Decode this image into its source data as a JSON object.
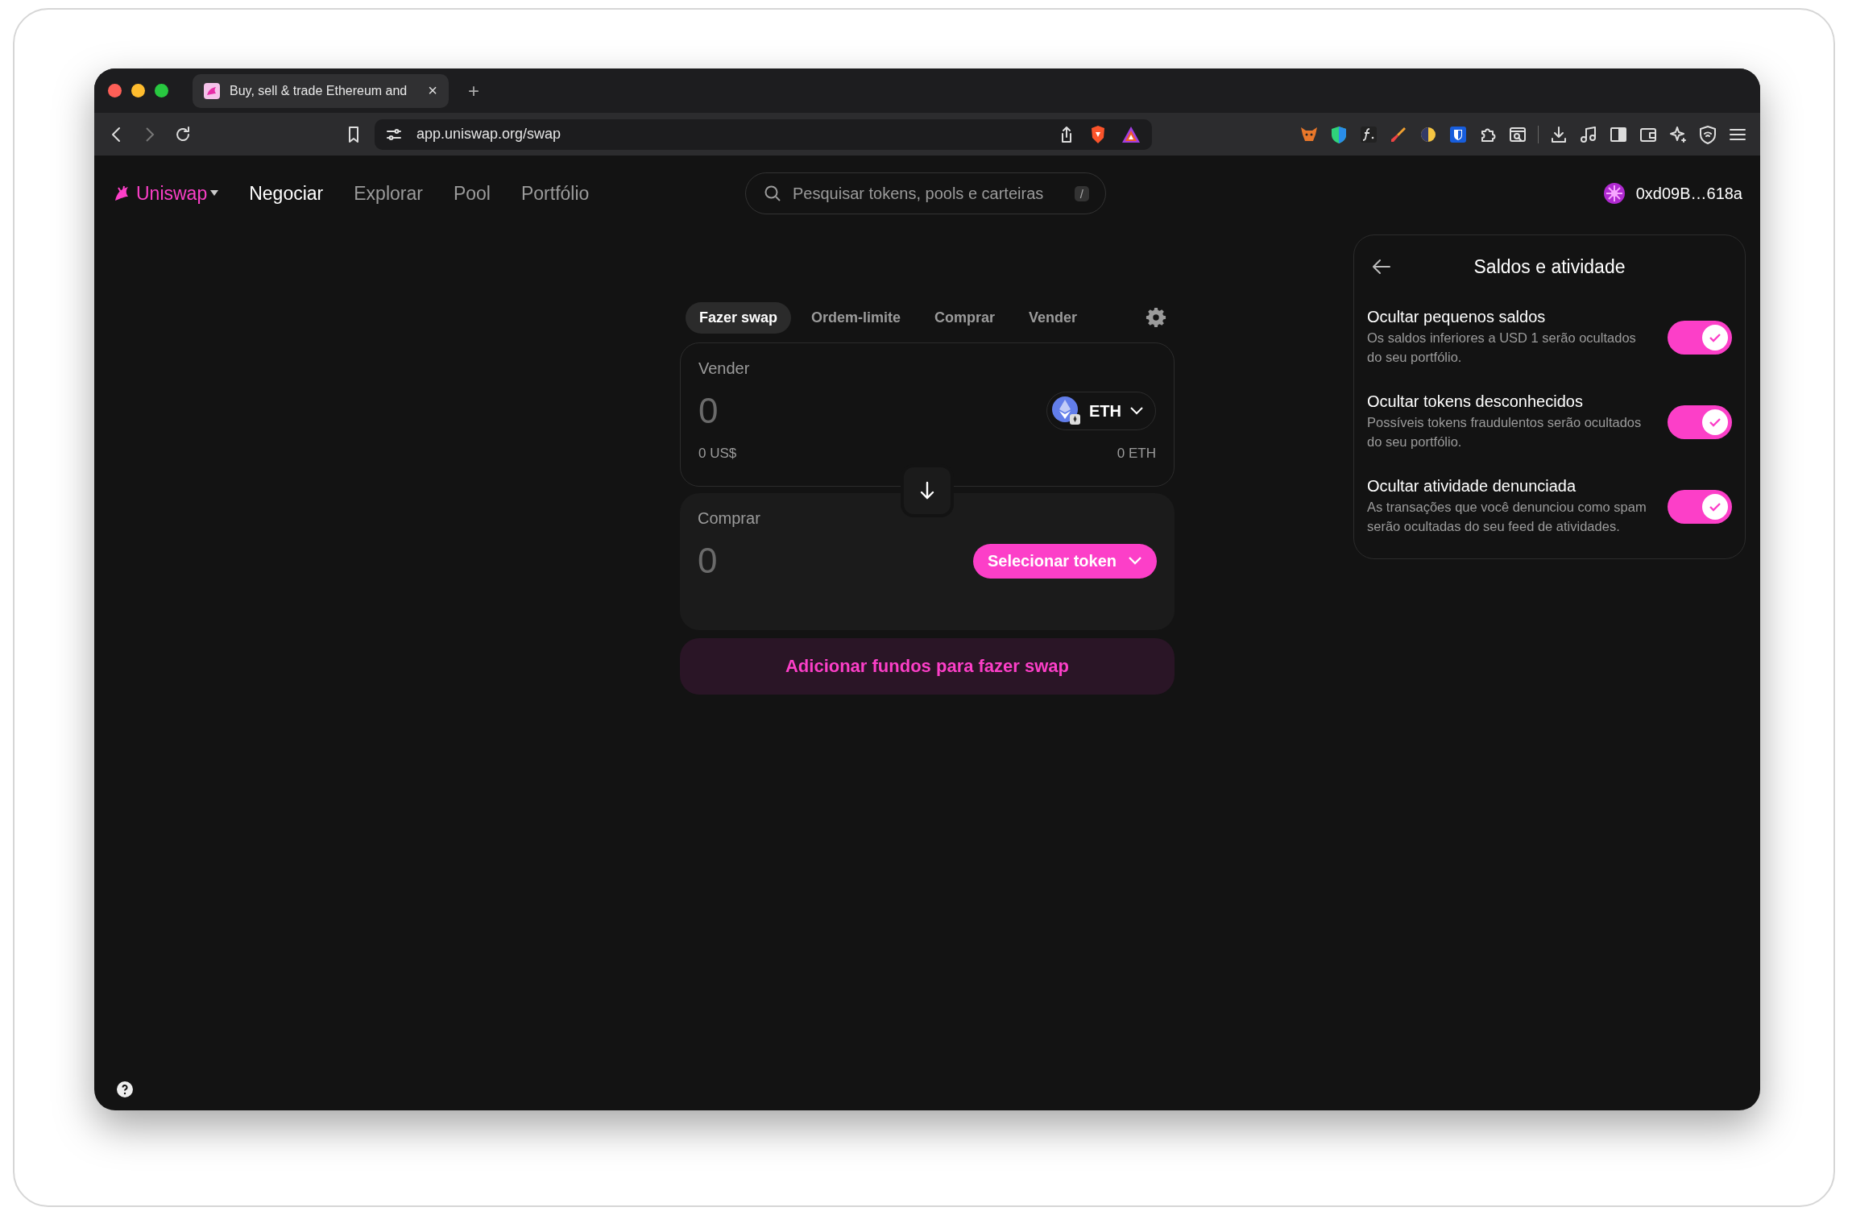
{
  "browser": {
    "tab_title": "Buy, sell & trade Ethereum and",
    "tab_close": "×",
    "new_tab": "+",
    "url": "app.uniswap.org/swap"
  },
  "nav": {
    "logo": "Uniswap",
    "links": [
      {
        "label": "Negociar",
        "selected": true
      },
      {
        "label": "Explorar",
        "selected": false
      },
      {
        "label": "Pool",
        "selected": false
      },
      {
        "label": "Portfólio",
        "selected": false
      }
    ],
    "search": {
      "placeholder": "Pesquisar tokens, pools e carteiras",
      "shortcut": "/"
    },
    "account": "0xd09B…618a"
  },
  "swap": {
    "tabs": [
      {
        "label": "Fazer swap",
        "selected": true
      },
      {
        "label": "Ordem-limite",
        "selected": false
      },
      {
        "label": "Comprar",
        "selected": false
      },
      {
        "label": "Vender",
        "selected": false
      }
    ],
    "sell": {
      "label": "Vender",
      "placeholder": "0",
      "fiat": "0 US$",
      "token": "ETH",
      "balance": "0 ETH"
    },
    "buy": {
      "label": "Comprar",
      "placeholder": "0",
      "button": "Selecionar token"
    },
    "action": "Adicionar fundos para fazer swap"
  },
  "panel": {
    "title": "Saldos e atividade",
    "settings": [
      {
        "title": "Ocultar pequenos saldos",
        "description": "Os saldos inferiores a USD 1 serão ocultados do seu portfólio.",
        "on": true
      },
      {
        "title": "Ocultar tokens desconhecidos",
        "description": "Possíveis tokens fraudulentos serão ocultados do seu portfólio.",
        "on": true
      },
      {
        "title": "Ocultar atividade denunciada",
        "description": "As transações que você denunciou como spam serão ocultadas do seu feed de atividades.",
        "on": true
      }
    ]
  }
}
